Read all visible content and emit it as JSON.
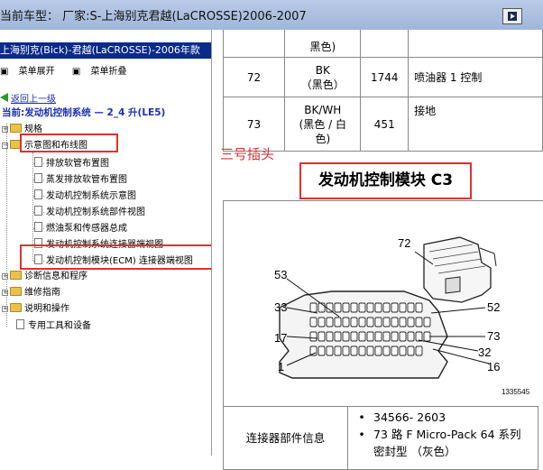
{
  "window": {
    "title": "当前车型：  厂家:S-上海别克君越(LaCROSSE)2006-2007",
    "restore_button_icon": "restore-icon"
  },
  "sidebar": {
    "header": "上海别克(Bick)-君越(LaCROSSE)-2006年款",
    "expand_all": "菜单展开",
    "collapse_all": "菜单折叠",
    "back_link": "返回上一级",
    "current": "当前:发动机控制系统 — 2_4 升(LE5)",
    "tree": [
      {
        "label": "规格"
      },
      {
        "label": "示意图和布线图"
      },
      {
        "label": "排放软管布置图"
      },
      {
        "label": "蒸发排放软管布置图"
      },
      {
        "label": "发动机控制系统示意图"
      },
      {
        "label": "发动机控制系统部件视图"
      },
      {
        "label": "燃油泵和传感器总成"
      },
      {
        "label": "发动机控制系统连接器端视图"
      },
      {
        "label": "发动机控制模块(ECM) 连接器端视图"
      },
      {
        "label": "诊断信息和程序"
      },
      {
        "label": "维修指南"
      },
      {
        "label": "说明和操作"
      },
      {
        "label": "专用工具和设备"
      }
    ]
  },
  "pin_table": {
    "top_partial": "黑色)",
    "rows": [
      {
        "pin": "72",
        "color": "BK",
        "color_cn": "（黑色）",
        "circuit": "1744",
        "function": "喷油器 1 控制"
      },
      {
        "pin": "73",
        "color": "BK/WH",
        "color_cn": "(黑色 / 白色)",
        "circuit": "451",
        "function": "接地"
      }
    ]
  },
  "annotation": "三号插头",
  "module_title": "发动机控制模块 C3",
  "diagram": {
    "pin_labels": [
      "72",
      "53",
      "52",
      "33",
      "73",
      "17",
      "32",
      "1",
      "16"
    ],
    "figure_number": "1335545"
  },
  "connector_info": {
    "label": "连接器部件信息",
    "items": [
      "34566- 2603",
      "73 路 F Micro-Pack 64 系列密封型 （灰色）"
    ]
  }
}
